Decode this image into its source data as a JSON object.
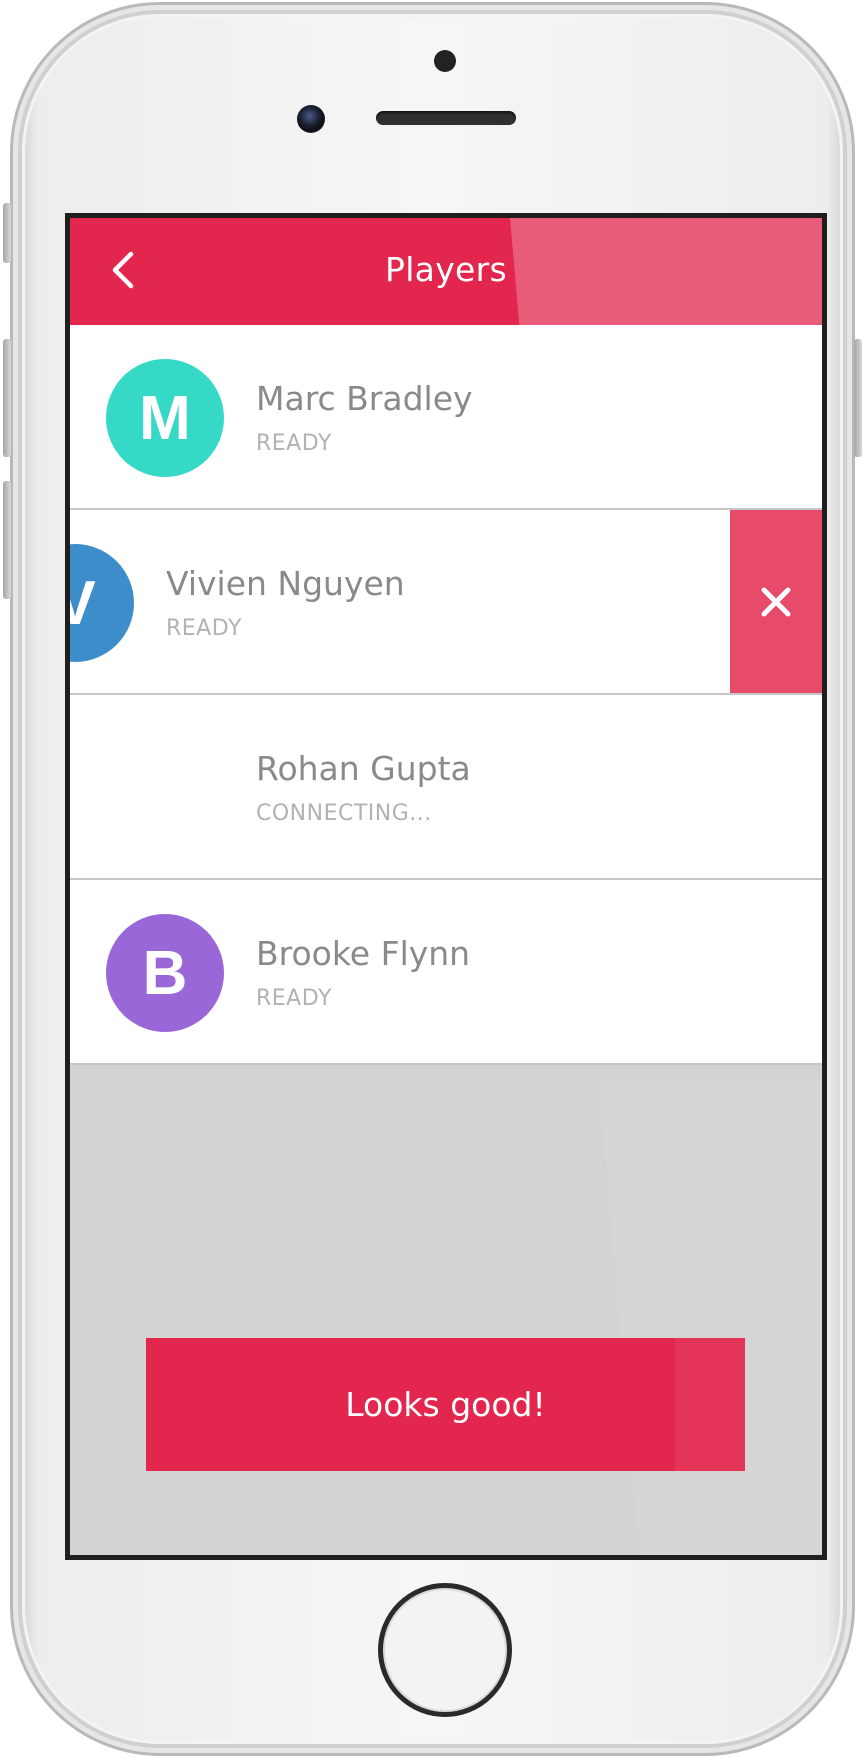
{
  "header": {
    "title": "Players",
    "back_icon": "chevron-left-icon"
  },
  "players": [
    {
      "name": "Marc Bradley",
      "status": "READY",
      "initial": "M",
      "avatar_color": "#36d8c6"
    },
    {
      "name": "Vivien Nguyen",
      "status": "READY",
      "initial": "V",
      "avatar_color": "#3d8dcb",
      "swiped": true
    },
    {
      "name": "Rohan Gupta",
      "status": "CONNECTING...",
      "initial": "",
      "avatar_color": "#c9c9c9",
      "avatar_icon": "placeholder-pixel-avatar"
    },
    {
      "name": "Brooke Flynn",
      "status": "READY",
      "initial": "B",
      "avatar_color": "#9a67d8"
    }
  ],
  "delete_action": {
    "icon": "close-icon",
    "color": "#e84a6a"
  },
  "confirm_button": {
    "label": "Looks good!"
  },
  "colors": {
    "accent": "#e2264d",
    "background": "#d3d3d3",
    "name_text": "#8a8a8a",
    "status_text": "#b2b2b2"
  }
}
